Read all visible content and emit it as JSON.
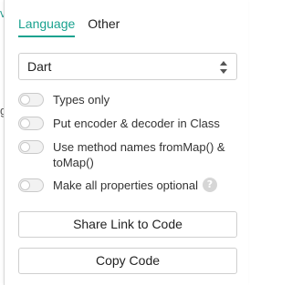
{
  "edge": {
    "left_char_1": "v",
    "left_char_2": "g"
  },
  "tabs": [
    {
      "label": "Language",
      "active": true
    },
    {
      "label": "Other",
      "active": false
    }
  ],
  "language_select": {
    "value": "Dart"
  },
  "options": [
    {
      "label": "Types only",
      "checked": false
    },
    {
      "label": "Put encoder & decoder in Class",
      "checked": false
    },
    {
      "label": "Use method names fromMap() & toMap()",
      "checked": false
    },
    {
      "label": "Make all properties optional",
      "checked": false,
      "help_icon": "question-icon",
      "help_glyph": "?"
    }
  ],
  "buttons": {
    "share": "Share Link to Code",
    "copy": "Copy Code"
  },
  "colors": {
    "accent": "#19a28f"
  }
}
